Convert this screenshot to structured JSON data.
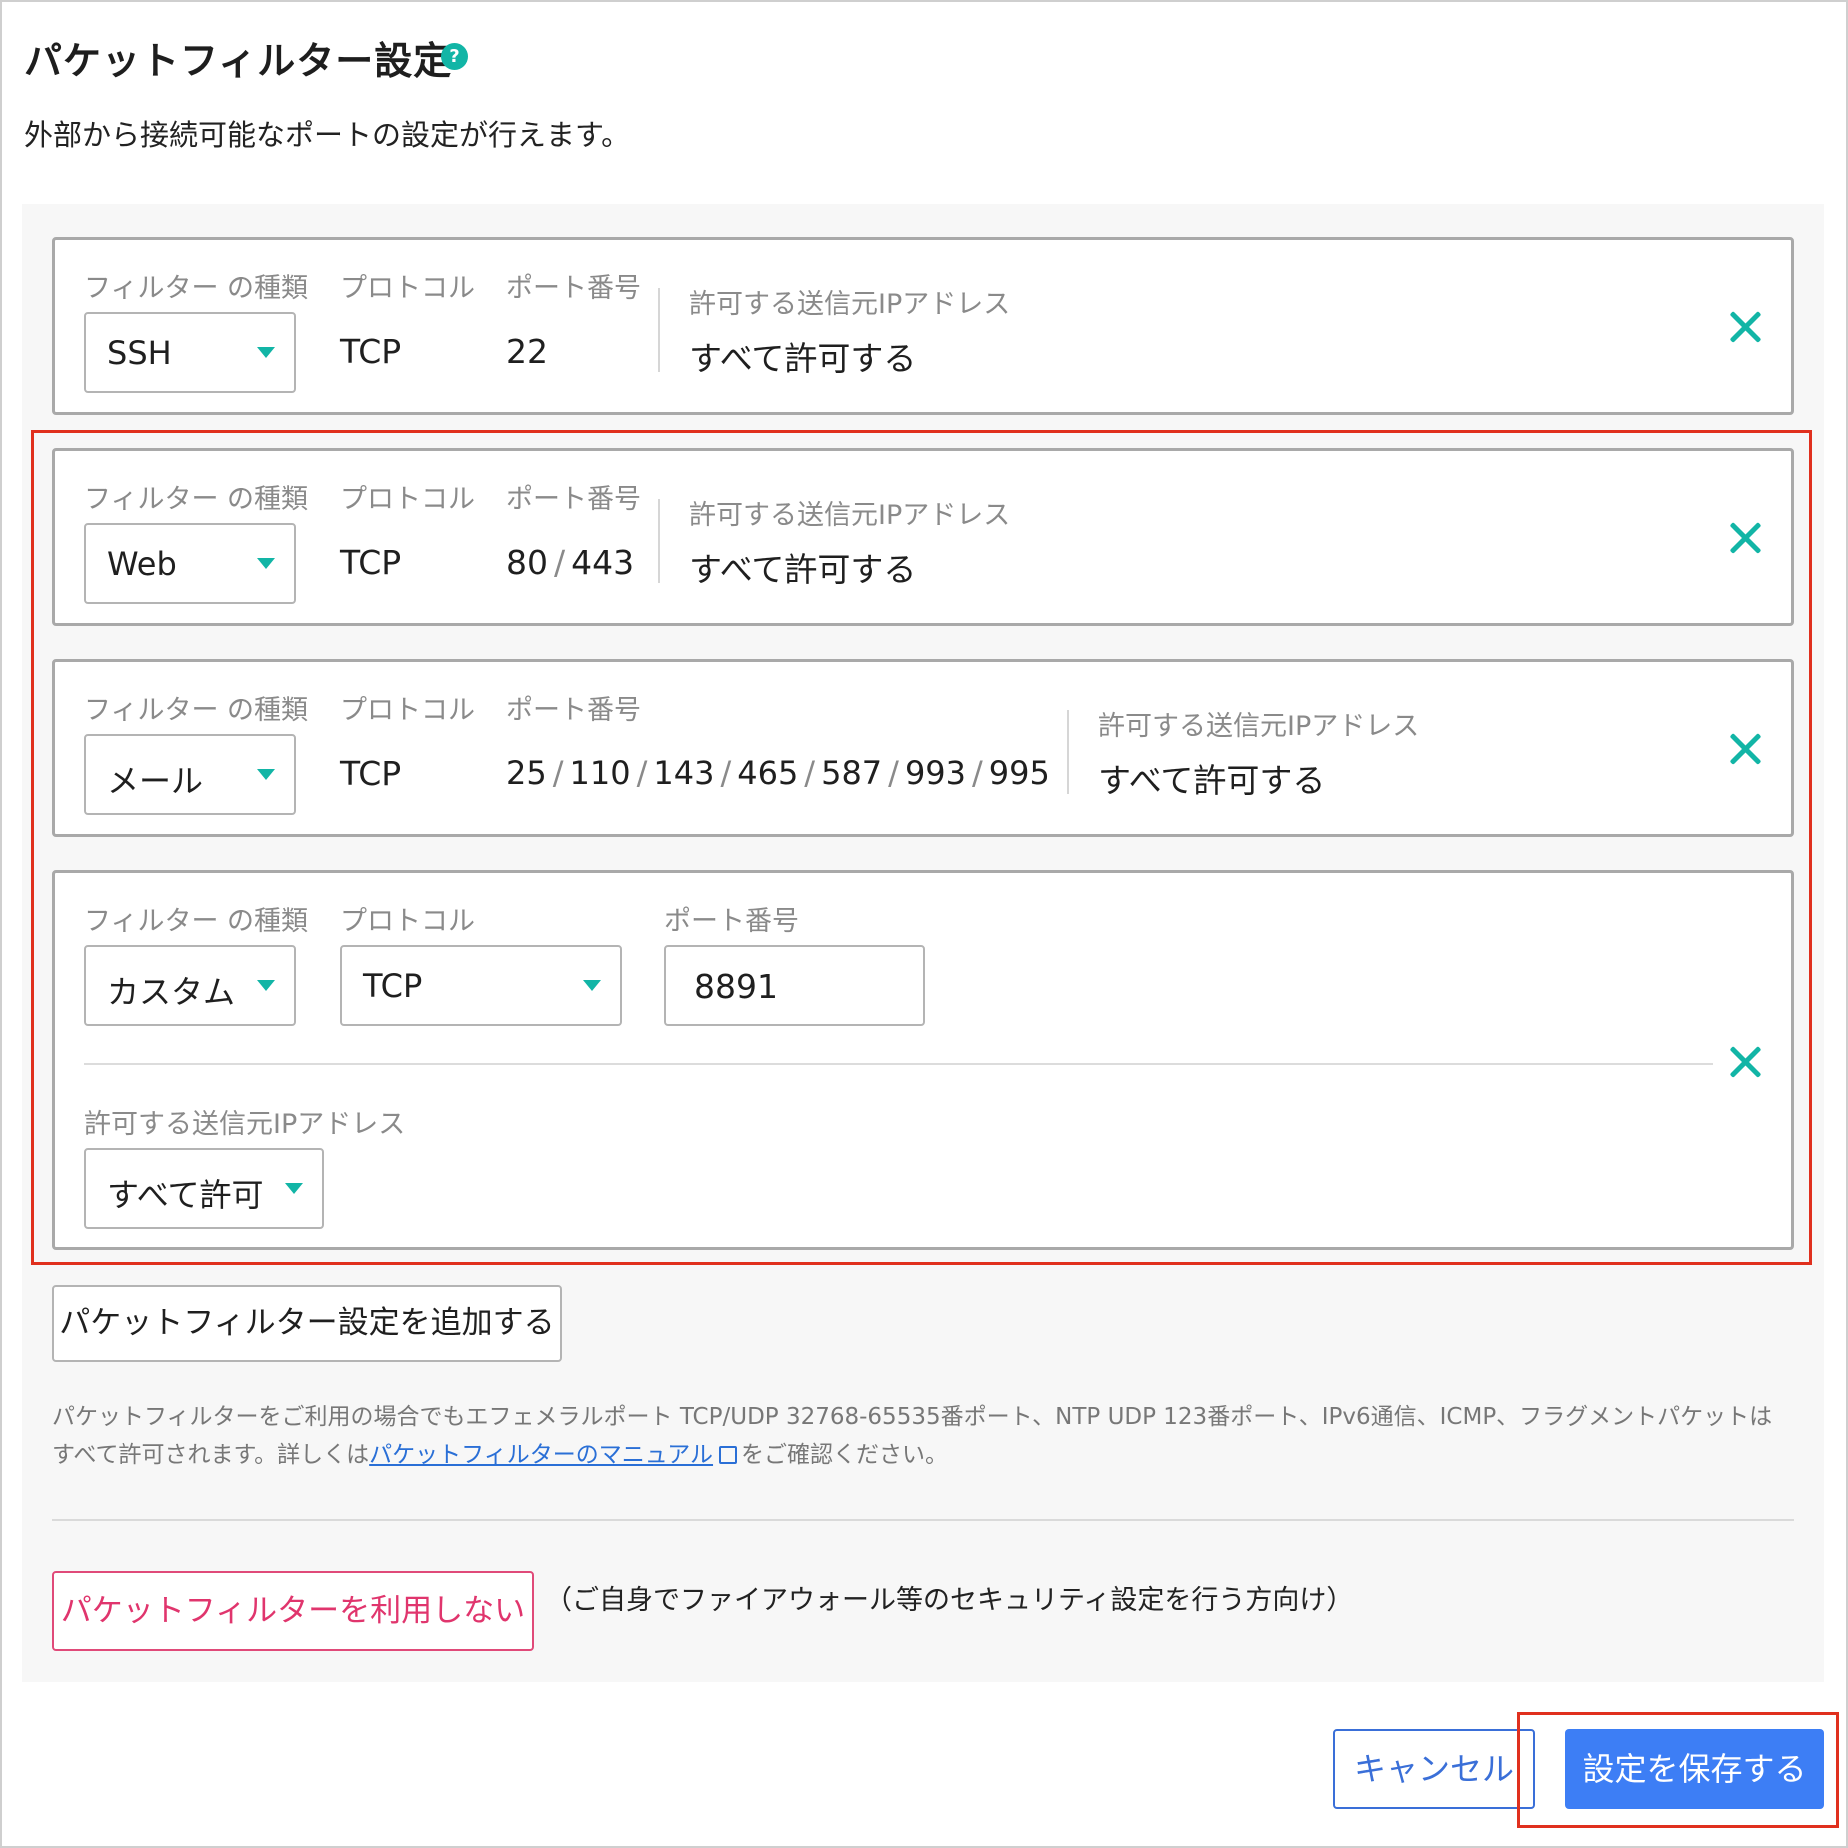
{
  "header": {
    "title": "パケットフィルター設定",
    "help_icon_glyph": "?",
    "description": "外部から接続可能なポートの設定が行えます。"
  },
  "labels": {
    "filter_type": "フィルター の種類",
    "protocol": "プロトコル",
    "port": "ポート番号",
    "source_ip": "許可する送信元IPアドレス"
  },
  "filters": [
    {
      "type": "SSH",
      "protocol": "TCP",
      "ports": [
        "22"
      ],
      "source_ip": "すべて許可する"
    },
    {
      "type": "Web",
      "protocol": "TCP",
      "ports": [
        "80",
        "443"
      ],
      "source_ip": "すべて許可する"
    },
    {
      "type": "メール",
      "protocol": "TCP",
      "ports": [
        "25",
        "110",
        "143",
        "465",
        "587",
        "993",
        "995"
      ],
      "source_ip": "すべて許可する"
    },
    {
      "type": "カスタム",
      "protocol": "TCP",
      "port": "8891",
      "source_ip": "すべて許可"
    }
  ],
  "port_separator": "/",
  "add_button": "パケットフィルター設定を追加する",
  "note": {
    "text_before": "パケットフィルターをご利用の場合でもエフェメラルポート TCP/UDP 32768-65535番ポート、NTP UDP 123番ポート、IPv6通信、ICMP、フラグメントパケットはすべて許可されます。詳しくは",
    "link": "パケットフィルターのマニュアル",
    "text_after": "をご確認ください。"
  },
  "disable_button": "パケットフィルターを利用しない",
  "disable_note": "（ご自身でファイアウォール等のセキュリティ設定を行う方向け）",
  "footer": {
    "cancel": "キャンセル",
    "save": "設定を保存する"
  },
  "colors": {
    "accent": "#12b5a6",
    "primary": "#3d7ef5",
    "danger": "#e0356d",
    "highlight": "#e0301e"
  }
}
